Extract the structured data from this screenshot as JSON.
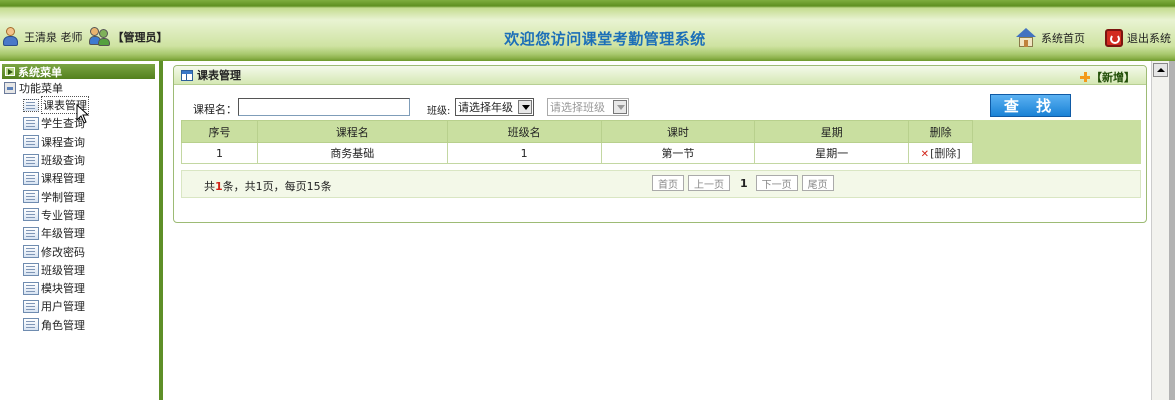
{
  "header": {
    "user_name": "王清泉 老师",
    "role": "【管理员】",
    "title": "欢迎您访问课堂考勤管理系统",
    "home_link": "系统首页",
    "exit_link": "退出系统"
  },
  "sidebar": {
    "heading": "系统菜单",
    "root": "功能菜单",
    "items": [
      {
        "label": "课表管理",
        "icon": "page-icon",
        "active": true
      },
      {
        "label": "学生查询",
        "icon": "page-icon"
      },
      {
        "label": "课程查询",
        "icon": "page-icon"
      },
      {
        "label": "班级查询",
        "icon": "page-icon"
      },
      {
        "label": "课程管理",
        "icon": "page-icon"
      },
      {
        "label": "学制管理",
        "icon": "page-icon"
      },
      {
        "label": "专业管理",
        "icon": "page-icon"
      },
      {
        "label": "年级管理",
        "icon": "page-icon"
      },
      {
        "label": "修改密码",
        "icon": "page-icon"
      },
      {
        "label": "班级管理",
        "icon": "page-icon"
      },
      {
        "label": "模块管理",
        "icon": "page-icon"
      },
      {
        "label": "用户管理",
        "icon": "page-icon"
      },
      {
        "label": "角色管理",
        "icon": "page-icon"
      }
    ]
  },
  "panel": {
    "title": "课表管理",
    "add_label": "【新增】"
  },
  "search": {
    "course_label": "课程名：",
    "course_value": "",
    "class_label": "班级:",
    "grade_selected": "请选择年级",
    "class_selected": "请选择班级",
    "search_button": "查 找"
  },
  "table": {
    "columns": [
      "序号",
      "课程名",
      "班级名",
      "课时",
      "星期",
      "删除"
    ],
    "rows": [
      {
        "index": "1",
        "course": "商务基础",
        "class": "1",
        "period": "第一节",
        "weekday": "星期一",
        "delete": "[删除]"
      }
    ]
  },
  "footer": {
    "total_prefix": "共",
    "total_count": "1",
    "total_suffix": "条，共1页，每页15条",
    "first": "首页",
    "prev": "上一页",
    "current": "1",
    "next": "下一页",
    "last": "尾页"
  },
  "colors": {
    "header_green": "#5f8f20",
    "title_blue": "#1c6fb8",
    "table_header": "#c9dfa0",
    "search_button": "#1a82d6",
    "delete_red": "#d2261b"
  }
}
